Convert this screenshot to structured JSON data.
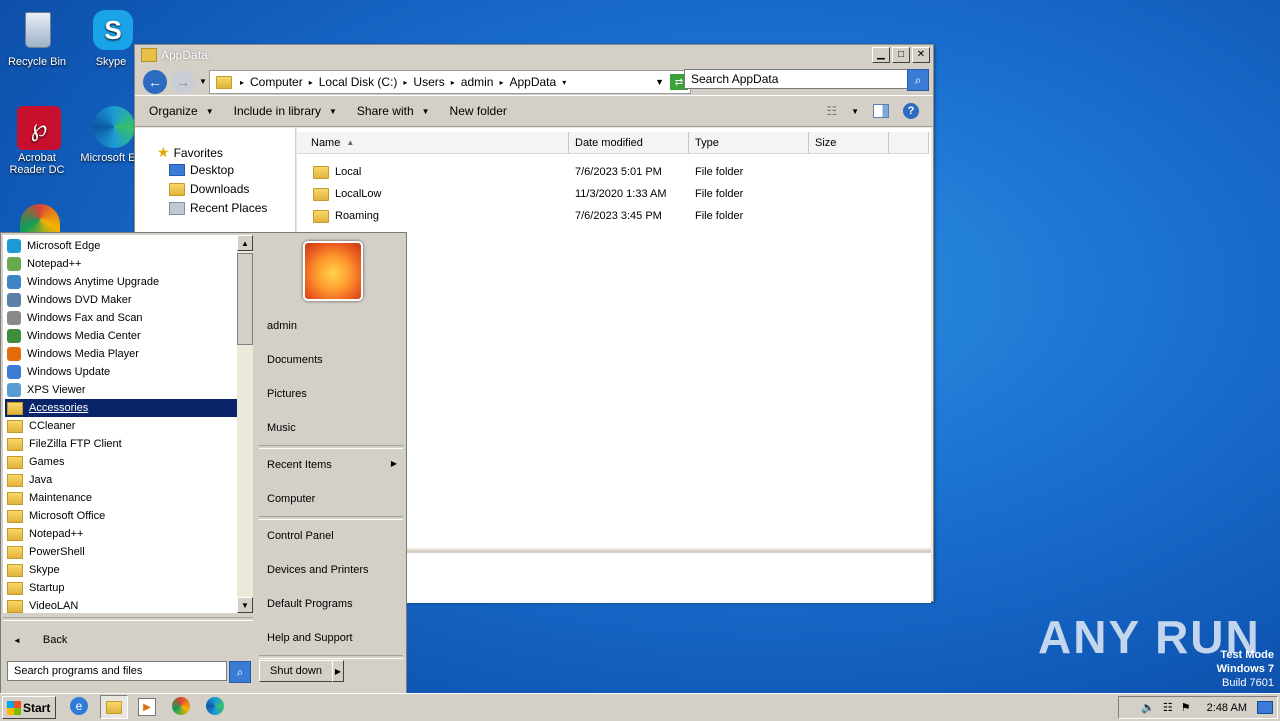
{
  "desktop": {
    "icons": [
      {
        "label": "Recycle Bin"
      },
      {
        "label": "Skype"
      },
      {
        "label": "Acrobat Reader DC"
      },
      {
        "label": "Microsoft Ed"
      }
    ],
    "watermark": {
      "brand": "ANY RUN",
      "line1": "Test Mode",
      "line2": "Windows 7",
      "line3": "Build 7601"
    }
  },
  "explorer": {
    "title": "AppData",
    "breadcrumb": [
      "Computer",
      "Local Disk (C:)",
      "Users",
      "admin",
      "AppData"
    ],
    "search_placeholder": "Search AppData",
    "toolbar": {
      "organize": "Organize",
      "include": "Include in library",
      "share": "Share with",
      "new_folder": "New folder"
    },
    "nav": {
      "favorites": "Favorites",
      "desktop": "Desktop",
      "downloads": "Downloads",
      "recent": "Recent Places"
    },
    "columns": {
      "name": "Name",
      "date": "Date modified",
      "type": "Type",
      "size": "Size"
    },
    "rows": [
      {
        "name": "Local",
        "date": "7/6/2023 5:01 PM",
        "type": "File folder"
      },
      {
        "name": "LocalLow",
        "date": "11/3/2020 1:33 AM",
        "type": "File folder"
      },
      {
        "name": "Roaming",
        "date": "7/6/2023 3:45 PM",
        "type": "File folder"
      }
    ]
  },
  "startmenu": {
    "programs": [
      "Microsoft Edge",
      "Notepad++",
      "Windows Anytime Upgrade",
      "Windows DVD Maker",
      "Windows Fax and Scan",
      "Windows Media Center",
      "Windows Media Player",
      "Windows Update",
      "XPS Viewer",
      "Accessories",
      "CCleaner",
      "FileZilla FTP Client",
      "Games",
      "Java",
      "Maintenance",
      "Microsoft Office",
      "Notepad++",
      "PowerShell",
      "Skype",
      "Startup",
      "VideoLAN"
    ],
    "selected_index": 9,
    "back": "Back",
    "search_placeholder": "Search programs and files",
    "right": {
      "user": "admin",
      "documents": "Documents",
      "pictures": "Pictures",
      "music": "Music",
      "recent": "Recent Items",
      "computer": "Computer",
      "control": "Control Panel",
      "devices": "Devices and Printers",
      "defaults": "Default Programs",
      "help": "Help and Support"
    },
    "shutdown": "Shut down"
  },
  "taskbar": {
    "start": "Start",
    "clock": "2:48 AM"
  }
}
